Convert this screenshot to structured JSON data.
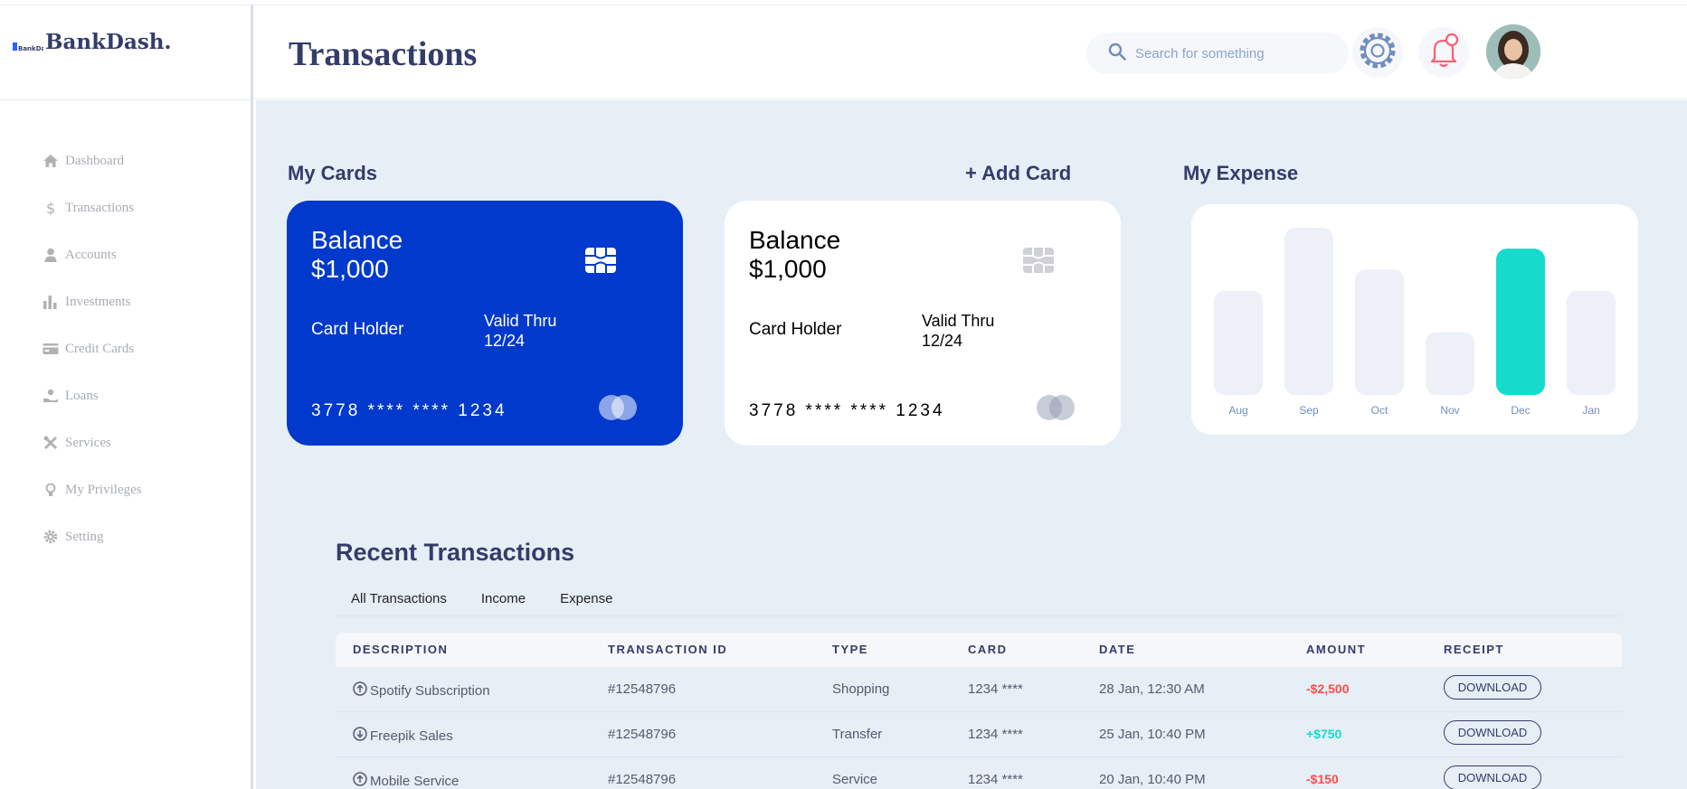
{
  "brand": {
    "logo_text": "BankDash",
    "name": "BankDash."
  },
  "sidebar": {
    "items": [
      {
        "label": "Dashboard",
        "icon": "home-icon"
      },
      {
        "label": "Transactions",
        "icon": "dollar-icon"
      },
      {
        "label": "Accounts",
        "icon": "user-icon"
      },
      {
        "label": "Investments",
        "icon": "bar-chart-icon"
      },
      {
        "label": "Credit Cards",
        "icon": "credit-card-icon"
      },
      {
        "label": "Loans",
        "icon": "hand-money-icon"
      },
      {
        "label": "Services",
        "icon": "tools-icon"
      },
      {
        "label": "My Privileges",
        "icon": "lightbulb-icon"
      },
      {
        "label": "Setting",
        "icon": "gear-icon"
      }
    ]
  },
  "header": {
    "title": "Transactions",
    "search_placeholder": "Search for something"
  },
  "cards_section": {
    "title": "My Cards",
    "add_label": "+ Add Card",
    "cards": [
      {
        "balance_label": "Balance",
        "balance": "$1,000",
        "holder_label": "Card Holder",
        "valid_label": "Valid Thru",
        "valid": "12/24",
        "number": "3778 **** **** 1234",
        "style": "blue"
      },
      {
        "balance_label": "Balance",
        "balance": "$1,000",
        "holder_label": "Card Holder",
        "valid_label": "Valid Thru",
        "valid": "12/24",
        "number": "3778 **** **** 1234",
        "style": "white"
      }
    ]
  },
  "expense": {
    "title": "My Expense",
    "chart_data": {
      "type": "bar",
      "categories": [
        "Aug",
        "Sep",
        "Oct",
        "Nov",
        "Dec",
        "Jan"
      ],
      "values": [
        5000,
        8000,
        6000,
        3000,
        7000,
        5000
      ],
      "highlight": "Dec",
      "colors": {
        "bar": "#edf0f7",
        "highlight": "#16dbcc",
        "label": "#718ebf"
      },
      "title": "",
      "xlabel": "",
      "ylabel": "",
      "ylim": [
        0,
        8000
      ]
    }
  },
  "transactions": {
    "title": "Recent Transactions",
    "tabs": [
      "All Transactions",
      "Income",
      "Expense"
    ],
    "columns": [
      "DESCRIPTION",
      "TRANSACTION ID",
      "TYPE",
      "CARD",
      "DATE",
      "AMOUNT",
      "RECEIPT"
    ],
    "rows": [
      {
        "direction": "up",
        "description": "Spotify Subscription",
        "id": "#12548796",
        "type": "Shopping",
        "card": "1234 ****",
        "date": "28 Jan, 12:30 AM",
        "amount": "-$2,500",
        "receipt": "DOWNLOAD"
      },
      {
        "direction": "down",
        "description": "Freepik Sales",
        "id": "#12548796",
        "type": "Transfer",
        "card": "1234 ****",
        "date": "25 Jan, 10:40 PM",
        "amount": "+$750",
        "receipt": "DOWNLOAD"
      },
      {
        "direction": "up",
        "description": "Mobile Service",
        "id": "#12548796",
        "type": "Service",
        "card": "1234 ****",
        "date": "20 Jan, 10:40 PM",
        "amount": "-$150",
        "receipt": "DOWNLOAD"
      }
    ]
  },
  "colors": {
    "primary": "#343c6a",
    "card_blue": "#0039cc",
    "negative": "#ff4b4a",
    "positive": "#16dbcc",
    "bell": "#fe5c73"
  }
}
